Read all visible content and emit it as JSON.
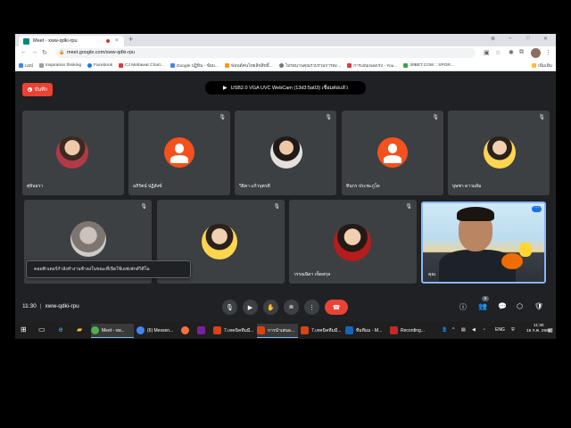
{
  "browser": {
    "tab_title": "Meet - xww-qdki-rpu",
    "tab_close": "×",
    "new_tab": "+",
    "url": "meet.google.com/xww-qdki-rpu",
    "window_controls": [
      "⊗",
      "–",
      "□",
      "✕"
    ]
  },
  "bookmarks": [
    {
      "label": "แอป",
      "color": "#4285f4"
    },
    {
      "label": "Inspiration thinking",
      "color": "#9e9e9e"
    },
    {
      "label": "Facebook",
      "color": "#1877f2"
    },
    {
      "label": "CJ Mettawat Chart...",
      "color": "#e53935"
    },
    {
      "label": "Google ปฏิทิน - ข้อม...",
      "color": "#4285f4"
    },
    {
      "label": "ฟอนต์คนไทยลิขสิทธิ์...",
      "color": "#ff9800"
    },
    {
      "label": "ไม่รอนานคุณรวบรวมการตะ...",
      "color": "#757575"
    },
    {
      "label": "การเล่นเพลงเร่ง - You...",
      "color": "#e53935"
    },
    {
      "label": "39BET.COM :: SPOR...",
      "color": "#43a047"
    },
    {
      "label": "เพิ่มเติม",
      "color": "#9e9e9e"
    }
  ],
  "meet": {
    "record_label": "บันทึก",
    "camera_toast": "USB2.0 VGA UVC WebCam (13d3:5a03) เชื่อมต่อแล้ว",
    "caption_toast": "คอมพิวเตอร์กำลังทำงานช้าลงในขณะที่เปิดใช้เอฟเฟกต์วิดีโอ",
    "meeting_time": "11:30",
    "meeting_code": "xww-qdki-rpu",
    "participant_count": "9",
    "self_label": "คุณ",
    "participants": [
      {
        "name": "ศุจินธรา",
        "muted": false
      },
      {
        "name": "อภิรัตน์ ปฏิสังข์",
        "muted": true
      },
      {
        "name": "วิธิดา แก้วบุตรดี",
        "muted": true
      },
      {
        "name": "ทินกร ประชะภูโด",
        "muted": true
      },
      {
        "name": "บุษชา ดาวแย้ม",
        "muted": true
      },
      {
        "name": "",
        "muted": true
      },
      {
        "name": "",
        "muted": true
      },
      {
        "name": "วรรณนิดา เข็ดสกุล",
        "muted": true
      }
    ]
  },
  "taskbar": {
    "items": [
      {
        "label": "Meet - xw...",
        "color": "#4caf50"
      },
      {
        "label": "(6) Messen...",
        "color": "#4285f4"
      },
      {
        "label": "",
        "color": "#ff7043"
      },
      {
        "label": "",
        "color": "#7b1fa2"
      },
      {
        "label": "7.เทคนิคทีมมี...",
        "color": "#d84315"
      },
      {
        "label": "การนำเสนอ...",
        "color": "#d84315"
      },
      {
        "label": "7.เทคนิคทีมมี...",
        "color": "#d84315"
      },
      {
        "label": "ทีมทีมม - M...",
        "color": "#1565c0"
      },
      {
        "label": "Recording...",
        "color": "#c62828"
      }
    ],
    "language": "ENG",
    "time": "11:30",
    "date": "15 ก.ค. 2564"
  }
}
